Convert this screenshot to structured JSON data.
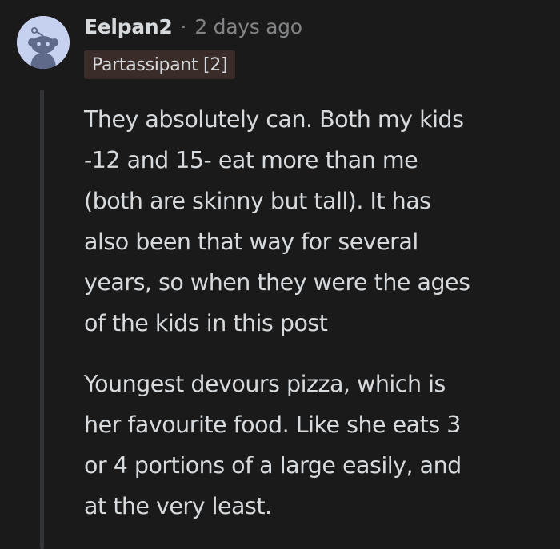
{
  "comment": {
    "username": "Eelpan2",
    "separator": "·",
    "timestamp": "2 days ago",
    "flair": "Partassipant [2]",
    "paragraphs": [
      {
        "lines": [
          "They absolutely can. Both my kids",
          "-12 and 15- eat more than me",
          "(both are skinny but tall). It has",
          "also been that way for several",
          "years, so when they were the ages",
          "of the kids in this post"
        ]
      },
      {
        "lines": [
          "Youngest devours pizza, which is",
          "her favourite food. Like she eats 3",
          "or 4 portions of a large easily, and",
          "at the very least."
        ]
      }
    ]
  },
  "colors": {
    "background": "#1a1a1b",
    "text": "#d7dadc",
    "muted": "#818384",
    "flair_bg": "#3a2c28",
    "avatar_bg": "#c6d0ef"
  },
  "icons": {
    "avatar": "reddit-snoo-avatar-icon"
  }
}
